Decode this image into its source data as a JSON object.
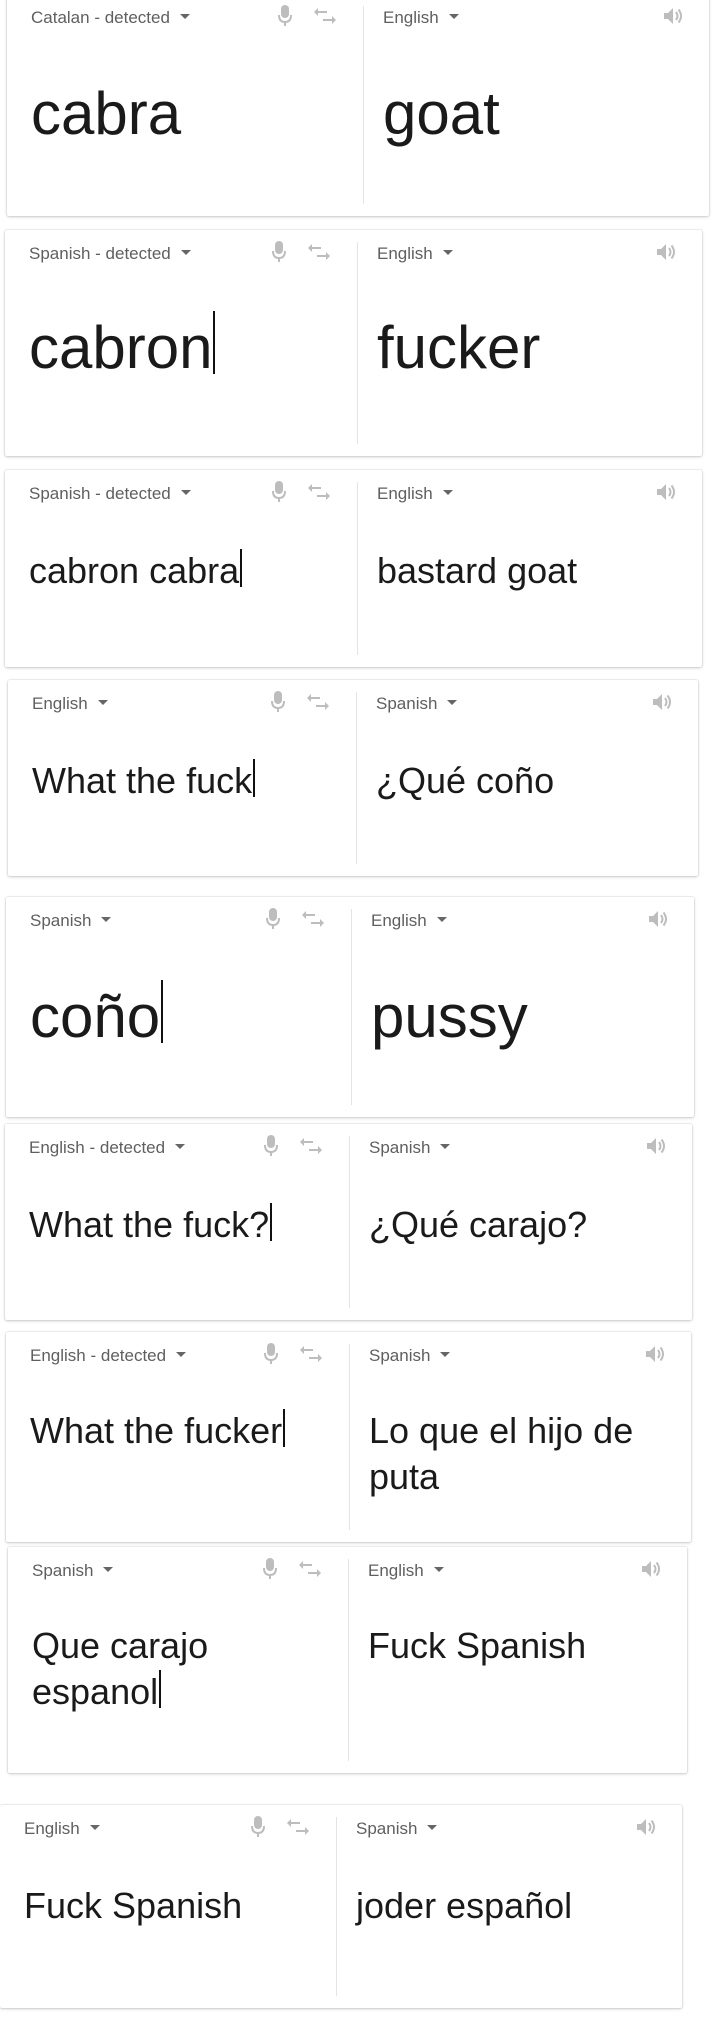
{
  "cards": [
    {
      "src_lang": "Catalan - detected",
      "tgt_lang": "English",
      "src_text": "cabra",
      "tgt_text": "goat",
      "cursor": false
    },
    {
      "src_lang": "Spanish - detected",
      "tgt_lang": "English",
      "src_text": "cabron",
      "tgt_text": "fucker",
      "cursor": true
    },
    {
      "src_lang": "Spanish - detected",
      "tgt_lang": "English",
      "src_text": "cabron cabra",
      "tgt_text": "bastard goat",
      "cursor": true
    },
    {
      "src_lang": "English",
      "tgt_lang": "Spanish",
      "src_text": "What the fuck",
      "tgt_text": "¿Qué coño",
      "cursor": true
    },
    {
      "src_lang": "Spanish",
      "tgt_lang": "English",
      "src_text": "coño",
      "tgt_text": "pussy",
      "cursor": true
    },
    {
      "src_lang": "English - detected",
      "tgt_lang": "Spanish",
      "src_text": "What the fuck?",
      "tgt_text": "¿Qué carajo?",
      "cursor": true
    },
    {
      "src_lang": "English - detected",
      "tgt_lang": "Spanish",
      "src_text": "What the fucker",
      "tgt_text": "Lo que el hijo de\nputa",
      "cursor": true
    },
    {
      "src_lang": "Spanish",
      "tgt_lang": "English",
      "src_text": "Que carajo\nespanol",
      "tgt_text": "Fuck Spanish",
      "cursor": true
    },
    {
      "src_lang": "English",
      "tgt_lang": "Spanish",
      "src_text": "Fuck Spanish",
      "tgt_text": "joder español",
      "cursor": false
    }
  ],
  "icons": {
    "mic": "microphone-icon",
    "swap": "swap-languages-icon",
    "speaker": "speaker-icon",
    "dropdown": "chevron-down-icon"
  },
  "colors": {
    "text": "#1a1a1a",
    "label": "#5f5f5f",
    "icon": "#bdbdbd"
  }
}
